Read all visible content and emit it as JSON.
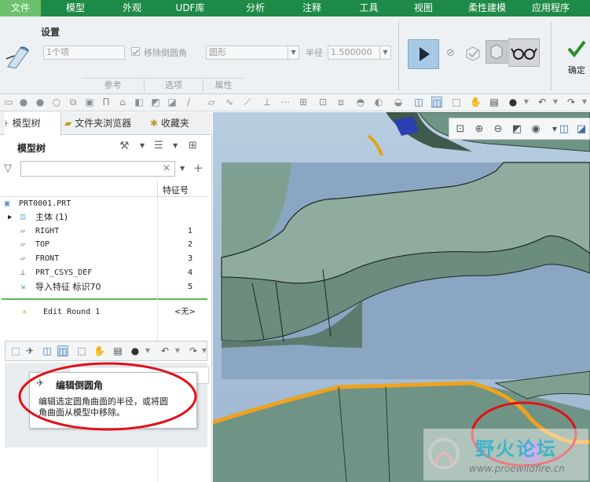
{
  "menu": {
    "items": [
      "文件",
      "模型",
      "外观",
      "UDF库",
      "分析",
      "注释",
      "工具",
      "视图",
      "柔性建模",
      "应用程序"
    ],
    "active_index": 0
  },
  "ribbon": {
    "settings_label": "设置",
    "references_field": "1个项",
    "remove_round_label": "移除倒圆角",
    "shape_dropdown": "圆形",
    "radius_label": "半径",
    "radius_value": "1.500000",
    "tabs": [
      "参考",
      "选项",
      "属性"
    ],
    "confirm_label": "确定"
  },
  "panel": {
    "tabs": [
      "模型树",
      "文件夹浏览器",
      "收藏夹"
    ],
    "title": "模型树",
    "feature_col": "特征号"
  },
  "tree": {
    "root": "PRT0001.PRT",
    "items": [
      {
        "label": "主体 (1)",
        "num": "",
        "icon": "body-icon"
      },
      {
        "label": "RIGHT",
        "num": "1",
        "icon": "datum-plane-icon"
      },
      {
        "label": "TOP",
        "num": "2",
        "icon": "datum-plane-icon"
      },
      {
        "label": "FRONT",
        "num": "3",
        "icon": "datum-plane-icon"
      },
      {
        "label": "PRT_CSYS_DEF",
        "num": "4",
        "icon": "csys-icon"
      },
      {
        "label": "导入特征 标识70",
        "num": "5",
        "icon": "import-feature-icon"
      }
    ],
    "edit_row": {
      "label": "Edit Round 1",
      "num": "<无>"
    }
  },
  "tooltip": {
    "title": "编辑倒圆角",
    "body_line1": "编辑选定圆角曲面的半径，或将圆",
    "body_line2": "角曲面从模型中移除。"
  },
  "watermark": {
    "brand": "野火论坛",
    "url": "www.proewildfire.cn"
  },
  "colors": {
    "menubar": "#1e8a47",
    "active_tab": "#6cc26c",
    "annotation_red": "#e0101a",
    "model_green": "#6f9486",
    "edge_orange": "#f0a21c"
  }
}
